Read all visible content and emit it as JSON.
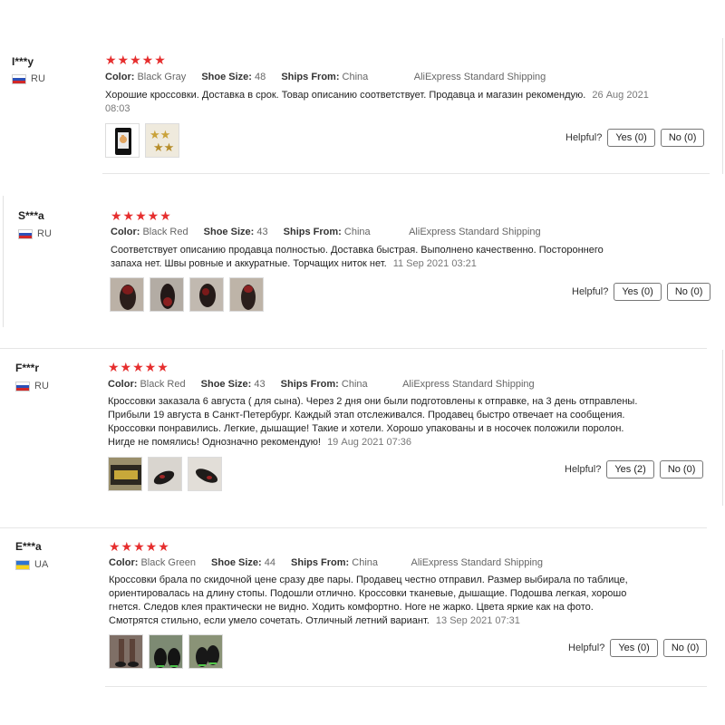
{
  "labels": {
    "color": "Color:",
    "shoe_size": "Shoe Size:",
    "ships_from": "Ships From:",
    "helpful": "Helpful?"
  },
  "reviews": [
    {
      "user": "I***y",
      "country": "RU",
      "stars": "★★★★★",
      "color": "Black Gray",
      "shoe_size": "48",
      "ships_from": "China",
      "shipping": "AliExpress Standard Shipping",
      "text": "Хорошие кроссовки. Доставка в срок. Товар описанию соответствует. Продавца и магазин рекомендую.",
      "date": "26 Aug 2021 08:03",
      "yes": "Yes (0)",
      "no": "No (0)"
    },
    {
      "user": "S***a",
      "country": "RU",
      "stars": "★★★★★",
      "color": "Black Red",
      "shoe_size": "43",
      "ships_from": "China",
      "shipping": "AliExpress Standard Shipping",
      "text": "Соответствует описанию продавца полностью. Доставка быстрая. Выполнено качественно. Постороннего запаха нет. Швы ровные и аккуратные. Торчащих ниток нет.",
      "date": "11 Sep 2021 03:21",
      "yes": "Yes (0)",
      "no": "No (0)"
    },
    {
      "user": "F***r",
      "country": "RU",
      "stars": "★★★★★",
      "color": "Black Red",
      "shoe_size": "43",
      "ships_from": "China",
      "shipping": "AliExpress Standard Shipping",
      "text": "Кроссовки заказала 6 августа ( для сына). Через 2 дня они были подготовлены к отправке, на 3 день отправлены. Прибыли 19 августа в Санкт-Петербург. Каждый этап отслеживался. Продавец быстро отвечает на сообщения. Кроссовки понравились. Легкие, дышащие! Такие и хотели. Хорошо упакованы и в носочек положили поролон. Нигде не помялись! Однозначно рекомендую!",
      "date": "19 Aug 2021 07:36",
      "yes": "Yes (2)",
      "no": "No (0)"
    },
    {
      "user": "E***a",
      "country": "UA",
      "stars": "★★★★★",
      "color": "Black Green",
      "shoe_size": "44",
      "ships_from": "China",
      "shipping": "AliExpress Standard Shipping",
      "text": "Кроссовки брала по скидочной цене сразу две пары. Продавец честно отправил. Размер выбирала по таблице, ориентировалась на длину стопы. Подошли отлично. Кроссовки тканевые, дышащие. Подошва легкая, хорошо гнется. Следов клея практически не видно. Ходить комфортно. Ноге не жарко. Цвета яркие как на фото. Смотрятся стильно, если умело сочетать. Отличный летний вариант.",
      "date": "13 Sep 2021 07:31",
      "yes": "Yes (0)",
      "no": "No (0)"
    }
  ]
}
